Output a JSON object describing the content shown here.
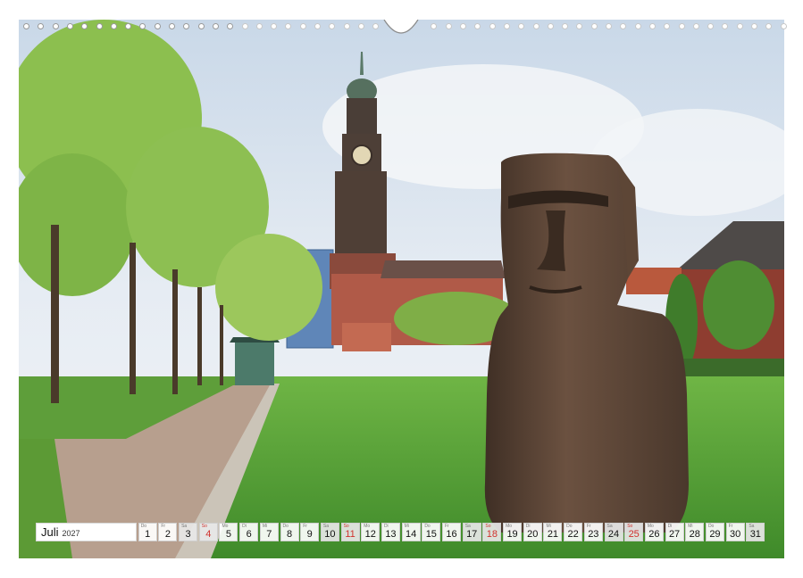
{
  "calendar": {
    "month": "Juli",
    "year": "2027",
    "days": [
      {
        "wd": "Do",
        "n": "1",
        "weekend": false,
        "holiday": false
      },
      {
        "wd": "Fr",
        "n": "2",
        "weekend": false,
        "holiday": false
      },
      {
        "wd": "Sa",
        "n": "3",
        "weekend": true,
        "holiday": false
      },
      {
        "wd": "So",
        "n": "4",
        "weekend": true,
        "holiday": true
      },
      {
        "wd": "Mo",
        "n": "5",
        "weekend": false,
        "holiday": false
      },
      {
        "wd": "Di",
        "n": "6",
        "weekend": false,
        "holiday": false
      },
      {
        "wd": "Mi",
        "n": "7",
        "weekend": false,
        "holiday": false
      },
      {
        "wd": "Do",
        "n": "8",
        "weekend": false,
        "holiday": false
      },
      {
        "wd": "Fr",
        "n": "9",
        "weekend": false,
        "holiday": false
      },
      {
        "wd": "Sa",
        "n": "10",
        "weekend": true,
        "holiday": false
      },
      {
        "wd": "So",
        "n": "11",
        "weekend": true,
        "holiday": true
      },
      {
        "wd": "Mo",
        "n": "12",
        "weekend": false,
        "holiday": false
      },
      {
        "wd": "Di",
        "n": "13",
        "weekend": false,
        "holiday": false
      },
      {
        "wd": "Mi",
        "n": "14",
        "weekend": false,
        "holiday": false
      },
      {
        "wd": "Do",
        "n": "15",
        "weekend": false,
        "holiday": false
      },
      {
        "wd": "Fr",
        "n": "16",
        "weekend": false,
        "holiday": false
      },
      {
        "wd": "Sa",
        "n": "17",
        "weekend": true,
        "holiday": false
      },
      {
        "wd": "So",
        "n": "18",
        "weekend": true,
        "holiday": true
      },
      {
        "wd": "Mo",
        "n": "19",
        "weekend": false,
        "holiday": false
      },
      {
        "wd": "Di",
        "n": "20",
        "weekend": false,
        "holiday": false
      },
      {
        "wd": "Mi",
        "n": "21",
        "weekend": false,
        "holiday": false
      },
      {
        "wd": "Do",
        "n": "22",
        "weekend": false,
        "holiday": false
      },
      {
        "wd": "Fr",
        "n": "23",
        "weekend": false,
        "holiday": false
      },
      {
        "wd": "Sa",
        "n": "24",
        "weekend": true,
        "holiday": false
      },
      {
        "wd": "So",
        "n": "25",
        "weekend": true,
        "holiday": true
      },
      {
        "wd": "Mo",
        "n": "26",
        "weekend": false,
        "holiday": false
      },
      {
        "wd": "Di",
        "n": "27",
        "weekend": false,
        "holiday": false
      },
      {
        "wd": "Mi",
        "n": "28",
        "weekend": false,
        "holiday": false
      },
      {
        "wd": "Do",
        "n": "29",
        "weekend": false,
        "holiday": false
      },
      {
        "wd": "Fr",
        "n": "30",
        "weekend": false,
        "holiday": false
      },
      {
        "wd": "Sa",
        "n": "31",
        "weekend": true,
        "holiday": false
      }
    ]
  },
  "colors": {
    "holiday": "#d0312d",
    "sky": "#dfe8f2",
    "grass": "#5fa83a",
    "statue": "#5a4435"
  }
}
